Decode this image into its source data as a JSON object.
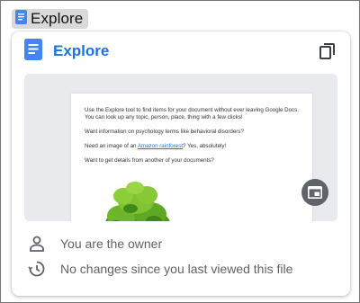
{
  "title_chip": {
    "label": "Explore",
    "icon": "docs-icon"
  },
  "card": {
    "title": "Explore",
    "app_icon": "docs-icon",
    "copy_icon": "copy-icon",
    "open_icon": "open-in-window-icon"
  },
  "preview": {
    "line1": "Use the Explore tool to find items for your document without ever leaving Google Docs.",
    "line2": "You can look up any topic, person, place, thing with a few clicks!",
    "line3": "Want information on psychology terms like behavioral disorders?",
    "line4_before": "Need an image of an ",
    "line4_link": "Amazon rainforest",
    "line4_after": "? Yes, absolutely!",
    "line5": "Want to get details from another of your documents?"
  },
  "info": {
    "owner": "You are the owner",
    "changes": "No changes since you last viewed this file"
  },
  "colors": {
    "accent": "#1a73e8",
    "docs_blue": "#4285f4",
    "muted": "#5f6368"
  }
}
